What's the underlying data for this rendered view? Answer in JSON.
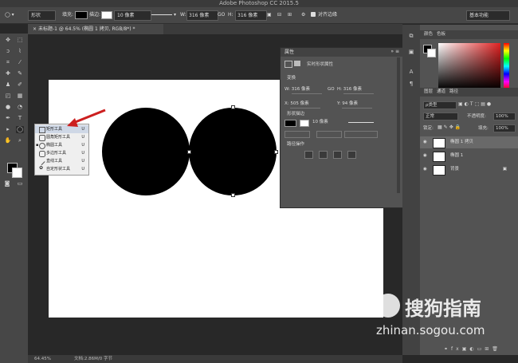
{
  "app_title": "Adobe Photoshop CC 2015.5",
  "options_bar": {
    "mode": "形状",
    "fill_label": "填充:",
    "stroke_label": "描边:",
    "stroke_width": "10 像素",
    "w_label": "W:",
    "w_value": "316 像素",
    "link": "GO",
    "h_label": "H:",
    "h_value": "316 像素",
    "align_edges": "对齐边缘",
    "workspace": "基本功能"
  },
  "doc_tab": "未标题-1 @ 64.5% (椭圆 1 拷贝, RGB/8*) *",
  "flyout": [
    {
      "label": "矩形工具",
      "shortcut": "U"
    },
    {
      "label": "圆角矩形工具",
      "shortcut": "U"
    },
    {
      "label": "椭圆工具",
      "shortcut": "U"
    },
    {
      "label": "多边形工具",
      "shortcut": "U"
    },
    {
      "label": "直线工具",
      "shortcut": "U"
    },
    {
      "label": "自定形状工具",
      "shortcut": "U"
    }
  ],
  "properties": {
    "title": "属性",
    "subtitle": "实时形状属性",
    "sec_transform": "变换",
    "w_label": "W:",
    "w_value": "316 像素",
    "link": "GO",
    "h_label": "H:",
    "h_value": "316 像素",
    "x_label": "X:",
    "x_value": "505 像素",
    "y_label": "Y:",
    "y_value": "94 像素",
    "sec_appearance": "形状描边",
    "stroke_width": "10 像素",
    "sec_ops": "路径操作"
  },
  "right_panel": {
    "tab_color": "颜色",
    "tab_swatches": "色板",
    "tab_layers": "图层",
    "tab_channels": "通道",
    "tab_paths": "路径",
    "filter": "ρ类型",
    "blend_mode": "正常",
    "opacity_label": "不透明度:",
    "opacity": "100%",
    "lock_label": "锁定:",
    "fill_label": "填充:",
    "fill": "100%",
    "layers": [
      "椭圆 1 拷贝",
      "椭圆 1",
      "背景"
    ]
  },
  "status": {
    "zoom": "64.45%",
    "doc": "文档:2.86M/0 字节"
  },
  "watermark": {
    "brand": "搜狗指南",
    "url": "zhinan.sogou.com"
  },
  "colors": {
    "accent_arrow": "#cc1f1f",
    "shape": "#000000"
  }
}
